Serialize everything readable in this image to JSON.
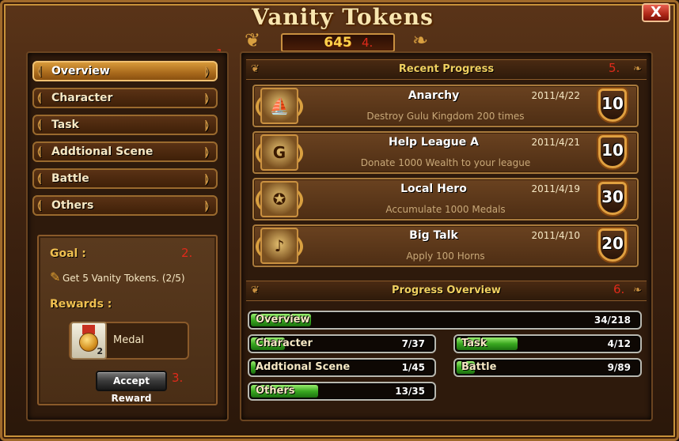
{
  "window": {
    "title": "Vanity Tokens",
    "close_label": "X"
  },
  "counter": {
    "value": "645"
  },
  "markers": {
    "m1": "1.",
    "m2": "2.",
    "m3": "3.",
    "m4": "4.",
    "m5": "5.",
    "m6": "6."
  },
  "nav": {
    "items": [
      {
        "label": "Overview",
        "active": true
      },
      {
        "label": "Character",
        "active": false
      },
      {
        "label": "Task",
        "active": false
      },
      {
        "label": "Addtional Scene",
        "active": false
      },
      {
        "label": "Battle",
        "active": false
      },
      {
        "label": "Others",
        "active": false
      }
    ]
  },
  "goal": {
    "label": "Goal :",
    "text": "Get 5 Vanity Tokens.  (2/5)",
    "rewards_label": "Rewards :",
    "reward_name": "Medal",
    "reward_count": "2",
    "accept_label": "Accept Reward"
  },
  "recent": {
    "header": "Recent Progress",
    "items": [
      {
        "title": "Anarchy",
        "date": "2011/4/22",
        "desc": "Destroy Gulu Kingdom 200 times",
        "points": "10",
        "icon": "ship-icon"
      },
      {
        "title": "Help League A",
        "date": "2011/4/21",
        "desc": "Donate 1000 Wealth to your league",
        "points": "10",
        "icon": "league-g-icon"
      },
      {
        "title": "Local Hero",
        "date": "2011/4/19",
        "desc": "Accumulate 1000 Medals",
        "points": "30",
        "icon": "medal-icon"
      },
      {
        "title": "Big Talk",
        "date": "2011/4/10",
        "desc": "Apply 100 Horns",
        "points": "20",
        "icon": "horn-icon"
      }
    ]
  },
  "overview": {
    "header": "Progress Overview",
    "rows": [
      {
        "label": "Overview",
        "value": "34/218",
        "fraction": 0.156
      },
      {
        "label": "Character",
        "value": "7/37",
        "fraction": 0.189
      },
      {
        "label": "Task",
        "value": "4/12",
        "fraction": 0.333
      },
      {
        "label": "Addtional Scene",
        "value": "1/45",
        "fraction": 0.022
      },
      {
        "label": "Battle",
        "value": "9/89",
        "fraction": 0.101
      },
      {
        "label": "Others",
        "value": "13/35",
        "fraction": 0.371
      }
    ]
  },
  "colors": {
    "accent": "#f0c050",
    "progress_green": "#3aa820",
    "marker_red": "#e02a1a"
  }
}
